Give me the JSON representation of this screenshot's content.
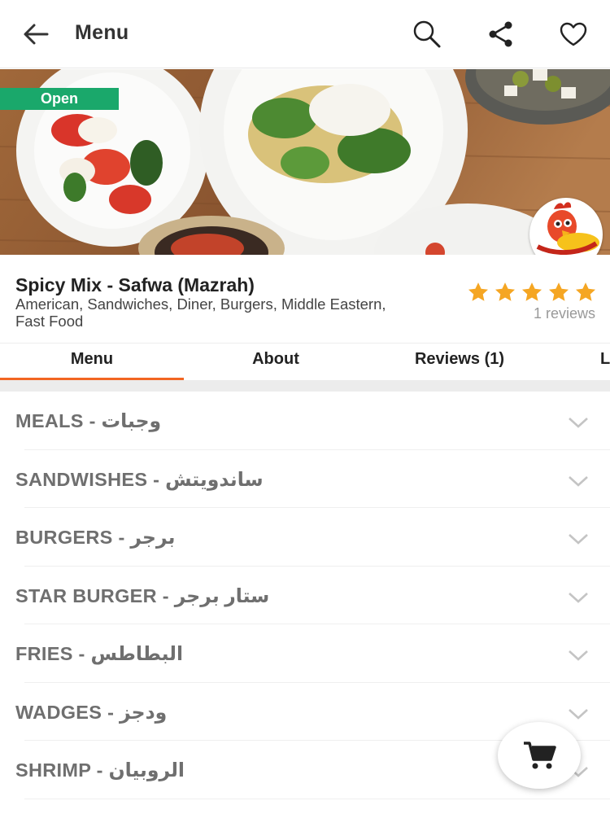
{
  "appbar": {
    "title": "Menu",
    "back_icon": "arrow-left-icon",
    "search_icon": "search-icon",
    "share_icon": "share-icon",
    "favorite_icon": "heart-icon"
  },
  "banner": {
    "status_badge": "Open",
    "status_color": "#1aa86b"
  },
  "restaurant": {
    "name": "Spicy Mix - Safwa (Mazrah)",
    "cuisines": "American, Sandwiches, Diner, Burgers, Middle Eastern, Fast Food",
    "rating": 5,
    "rating_max": 5,
    "reviews_text": "1 reviews",
    "star_color": "#f5a623"
  },
  "tabs": [
    {
      "label": "Menu",
      "active": true
    },
    {
      "label": "About",
      "active": false
    },
    {
      "label": "Reviews (1)",
      "active": false
    },
    {
      "label": "L",
      "active": false
    }
  ],
  "accent_color": "#f26522",
  "categories": [
    {
      "label": "MEALS - وجبات"
    },
    {
      "label": "SANDWISHES - ساندويتش"
    },
    {
      "label": "BURGERS - برجر"
    },
    {
      "label": "STAR BURGER - ستار برجر"
    },
    {
      "label": "FRIES - البطاطس"
    },
    {
      "label": "WADGES - ودجز"
    },
    {
      "label": "SHRIMP - الروبيان"
    }
  ],
  "cart_icon": "cart-icon"
}
